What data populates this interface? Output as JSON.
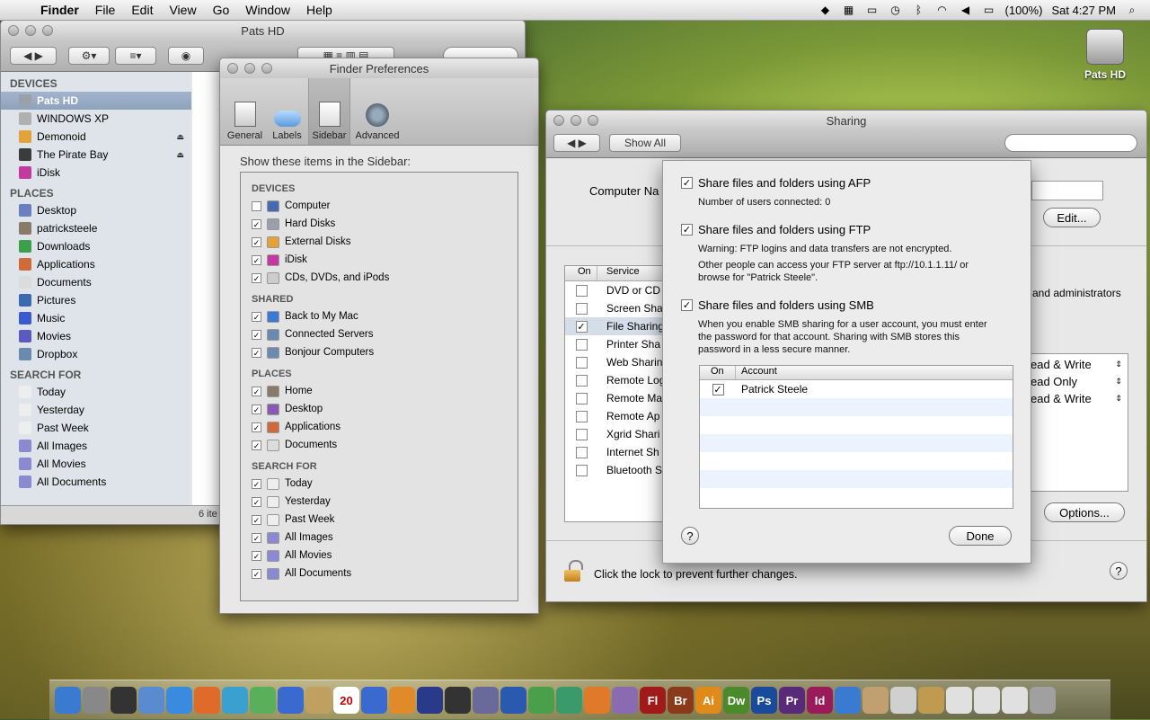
{
  "menubar": {
    "app": "Finder",
    "items": [
      "File",
      "Edit",
      "View",
      "Go",
      "Window",
      "Help"
    ],
    "battery": "(100%)",
    "clock": "Sat 4:27 PM"
  },
  "desktop": {
    "drive_label": "Pats HD"
  },
  "finder": {
    "title": "Pats HD",
    "status": "6 ite",
    "sections": [
      {
        "title": "DEVICES",
        "items": [
          {
            "label": "Pats HD",
            "icon": "hard-disk-icon",
            "color": "#9aa0a8",
            "selected": true
          },
          {
            "label": "WINDOWS XP",
            "icon": "hard-disk-icon",
            "color": "#b0b0b0"
          },
          {
            "label": "Demonoid",
            "icon": "disk-icon",
            "color": "#e3a23a",
            "eject": true
          },
          {
            "label": "The Pirate Bay",
            "icon": "book-icon",
            "color": "#3b3b3b",
            "eject": true
          },
          {
            "label": "iDisk",
            "icon": "idisk-icon",
            "color": "#c23aa0"
          }
        ]
      },
      {
        "title": "PLACES",
        "items": [
          {
            "label": "Desktop",
            "icon": "desktop-icon",
            "color": "#6a7fc0"
          },
          {
            "label": "patricksteele",
            "icon": "home-icon",
            "color": "#8a7a6a"
          },
          {
            "label": "Downloads",
            "icon": "downloads-icon",
            "color": "#3aa04a"
          },
          {
            "label": "Applications",
            "icon": "applications-icon",
            "color": "#d06a3a"
          },
          {
            "label": "Documents",
            "icon": "documents-icon",
            "color": "#dcdcdc"
          },
          {
            "label": "Pictures",
            "icon": "pictures-icon",
            "color": "#3a6ab0"
          },
          {
            "label": "Music",
            "icon": "music-icon",
            "color": "#3a5ad0"
          },
          {
            "label": "Movies",
            "icon": "movies-icon",
            "color": "#5a5ac0"
          },
          {
            "label": "Dropbox",
            "icon": "dropbox-icon",
            "color": "#6a8ab0"
          }
        ]
      },
      {
        "title": "SEARCH FOR",
        "items": [
          {
            "label": "Today",
            "icon": "clock-icon",
            "color": "#eeeeee"
          },
          {
            "label": "Yesterday",
            "icon": "clock-icon",
            "color": "#eeeeee"
          },
          {
            "label": "Past Week",
            "icon": "clock-icon",
            "color": "#eeeeee"
          },
          {
            "label": "All Images",
            "icon": "smart-folder-icon",
            "color": "#8a8ad0"
          },
          {
            "label": "All Movies",
            "icon": "smart-folder-icon",
            "color": "#8a8ad0"
          },
          {
            "label": "All Documents",
            "icon": "smart-folder-icon",
            "color": "#8a8ad0"
          }
        ]
      }
    ]
  },
  "prefs": {
    "title": "Finder Preferences",
    "tabs": [
      {
        "label": "General",
        "icon": "switch-icon"
      },
      {
        "label": "Labels",
        "icon": "label-icon"
      },
      {
        "label": "Sidebar",
        "icon": "sidebar-icon",
        "selected": true
      },
      {
        "label": "Advanced",
        "icon": "gear-icon"
      }
    ],
    "heading": "Show these items in the Sidebar:",
    "groups": [
      {
        "title": "DEVICES",
        "items": [
          {
            "label": "Computer",
            "checked": false,
            "color": "#4a6ab0"
          },
          {
            "label": "Hard Disks",
            "checked": true,
            "color": "#9aa0a8"
          },
          {
            "label": "External Disks",
            "checked": true,
            "color": "#e3a23a"
          },
          {
            "label": "iDisk",
            "checked": true,
            "color": "#c23aa0"
          },
          {
            "label": "CDs, DVDs, and iPods",
            "checked": true,
            "color": "#cccccc"
          }
        ]
      },
      {
        "title": "SHARED",
        "items": [
          {
            "label": "Back to My Mac",
            "checked": true,
            "color": "#3a7ad0"
          },
          {
            "label": "Connected Servers",
            "checked": true,
            "color": "#6a8ab0"
          },
          {
            "label": "Bonjour Computers",
            "checked": true,
            "color": "#6a8ab0"
          }
        ]
      },
      {
        "title": "PLACES",
        "items": [
          {
            "label": "Home",
            "checked": true,
            "color": "#8a7a6a"
          },
          {
            "label": "Desktop",
            "checked": true,
            "color": "#8a5ab0"
          },
          {
            "label": "Applications",
            "checked": true,
            "color": "#d06a3a"
          },
          {
            "label": "Documents",
            "checked": true,
            "color": "#dcdcdc"
          }
        ]
      },
      {
        "title": "SEARCH FOR",
        "items": [
          {
            "label": "Today",
            "checked": true,
            "color": "#eeeeee"
          },
          {
            "label": "Yesterday",
            "checked": true,
            "color": "#eeeeee"
          },
          {
            "label": "Past Week",
            "checked": true,
            "color": "#eeeeee"
          },
          {
            "label": "All Images",
            "checked": true,
            "color": "#8a8ad0"
          },
          {
            "label": "All Movies",
            "checked": true,
            "color": "#8a8ad0"
          },
          {
            "label": "All Documents",
            "checked": true,
            "color": "#8a8ad0"
          }
        ]
      }
    ]
  },
  "sharing": {
    "title": "Sharing",
    "show_all": "Show All",
    "computer_name_label": "Computer Na",
    "edit_button": "Edit...",
    "table_head": {
      "on": "On",
      "service": "Service"
    },
    "services": [
      {
        "label": "DVD or CD",
        "on": false
      },
      {
        "label": "Screen Sha",
        "on": false
      },
      {
        "label": "File Sharing",
        "on": true,
        "selected": true
      },
      {
        "label": "Printer Sha",
        "on": false
      },
      {
        "label": "Web Sharin",
        "on": false
      },
      {
        "label": "Remote Log",
        "on": false
      },
      {
        "label": "Remote Ma",
        "on": false
      },
      {
        "label": "Remote Ap",
        "on": false
      },
      {
        "label": "Xgrid Shari",
        "on": false
      },
      {
        "label": "Internet Sh",
        "on": false
      },
      {
        "label": "Bluetooth S",
        "on": false
      }
    ],
    "right_text": "and administrators",
    "permissions": [
      "ead & Write",
      "ead Only",
      "ead & Write"
    ],
    "options_button": "Options...",
    "lock_text": "Click the lock to prevent further changes."
  },
  "options": {
    "afp_label": "Share files and folders using AFP",
    "afp_info": "Number of users connected: 0",
    "ftp_label": "Share files and folders using FTP",
    "ftp_warning": "Warning: FTP logins and data transfers are not encrypted.",
    "ftp_info_1": "Other people can access your FTP server at ftp://10.1.1.11/ or",
    "ftp_info_2": "browse for \"Patrick Steele\".",
    "smb_label": "Share files and folders using SMB",
    "smb_info_1": "When you enable SMB sharing for a user account, you must enter",
    "smb_info_2": "the password for that account. Sharing with SMB stores this",
    "smb_info_3": "password in a less secure manner.",
    "table_head": {
      "on": "On",
      "account": "Account"
    },
    "accounts": [
      {
        "name": "Patrick Steele",
        "on": true
      }
    ],
    "done_button": "Done"
  },
  "dock": [
    {
      "name": "finder",
      "color": "#3a7ad0",
      "text": ""
    },
    {
      "name": "system-preferences",
      "color": "#888888",
      "text": ""
    },
    {
      "name": "dashboard",
      "color": "#333333",
      "text": ""
    },
    {
      "name": "mail",
      "color": "#5a8ad0",
      "text": ""
    },
    {
      "name": "safari",
      "color": "#3a8ae0",
      "text": ""
    },
    {
      "name": "firefox",
      "color": "#e06a2a",
      "text": ""
    },
    {
      "name": "messenger",
      "color": "#3aa0d0",
      "text": ""
    },
    {
      "name": "adium",
      "color": "#5ab05a",
      "text": ""
    },
    {
      "name": "ichat",
      "color": "#3a6ad0",
      "text": ""
    },
    {
      "name": "address-book",
      "color": "#c0a060",
      "text": ""
    },
    {
      "name": "ical",
      "color": "#ffffff",
      "text": "20"
    },
    {
      "name": "itunes",
      "color": "#3a6ad0",
      "text": ""
    },
    {
      "name": "vlc",
      "color": "#e08a2a",
      "text": ""
    },
    {
      "name": "bird",
      "color": "#2a3a8a",
      "text": ""
    },
    {
      "name": "clapboard",
      "color": "#333333",
      "text": ""
    },
    {
      "name": "vmware",
      "color": "#6a6a9a",
      "text": ""
    },
    {
      "name": "word",
      "color": "#2a5ab0",
      "text": ""
    },
    {
      "name": "excel-like",
      "color": "#4aa04a",
      "text": ""
    },
    {
      "name": "messenger2",
      "color": "#3a9a6a",
      "text": ""
    },
    {
      "name": "powerpoint",
      "color": "#e07a2a",
      "text": ""
    },
    {
      "name": "entourage",
      "color": "#8a6ab0",
      "text": ""
    },
    {
      "name": "flash",
      "color": "#a01a1a",
      "text": "Fl"
    },
    {
      "name": "bridge",
      "color": "#8a3a1a",
      "text": "Br"
    },
    {
      "name": "illustrator",
      "color": "#e08a1a",
      "text": "Ai"
    },
    {
      "name": "dreamweaver",
      "color": "#4a8a2a",
      "text": "Dw"
    },
    {
      "name": "photoshop",
      "color": "#1a4a9a",
      "text": "Ps"
    },
    {
      "name": "premiere",
      "color": "#5a2a7a",
      "text": "Pr"
    },
    {
      "name": "indesign",
      "color": "#9a1a5a",
      "text": "Id"
    },
    {
      "name": "quicktime",
      "color": "#3a7ad0",
      "text": ""
    },
    {
      "name": "stacks-apps",
      "color": "#c0a070",
      "text": ""
    },
    {
      "name": "documents-stack",
      "color": "#d0d0d0",
      "text": ""
    },
    {
      "name": "downloads-stack",
      "color": "#c09a50",
      "text": ""
    },
    {
      "name": "stack-1",
      "color": "#e0e0e0",
      "text": ""
    },
    {
      "name": "stack-2",
      "color": "#e0e0e0",
      "text": ""
    },
    {
      "name": "stack-3",
      "color": "#e0e0e0",
      "text": ""
    },
    {
      "name": "trash",
      "color": "#a0a0a0",
      "text": ""
    }
  ]
}
